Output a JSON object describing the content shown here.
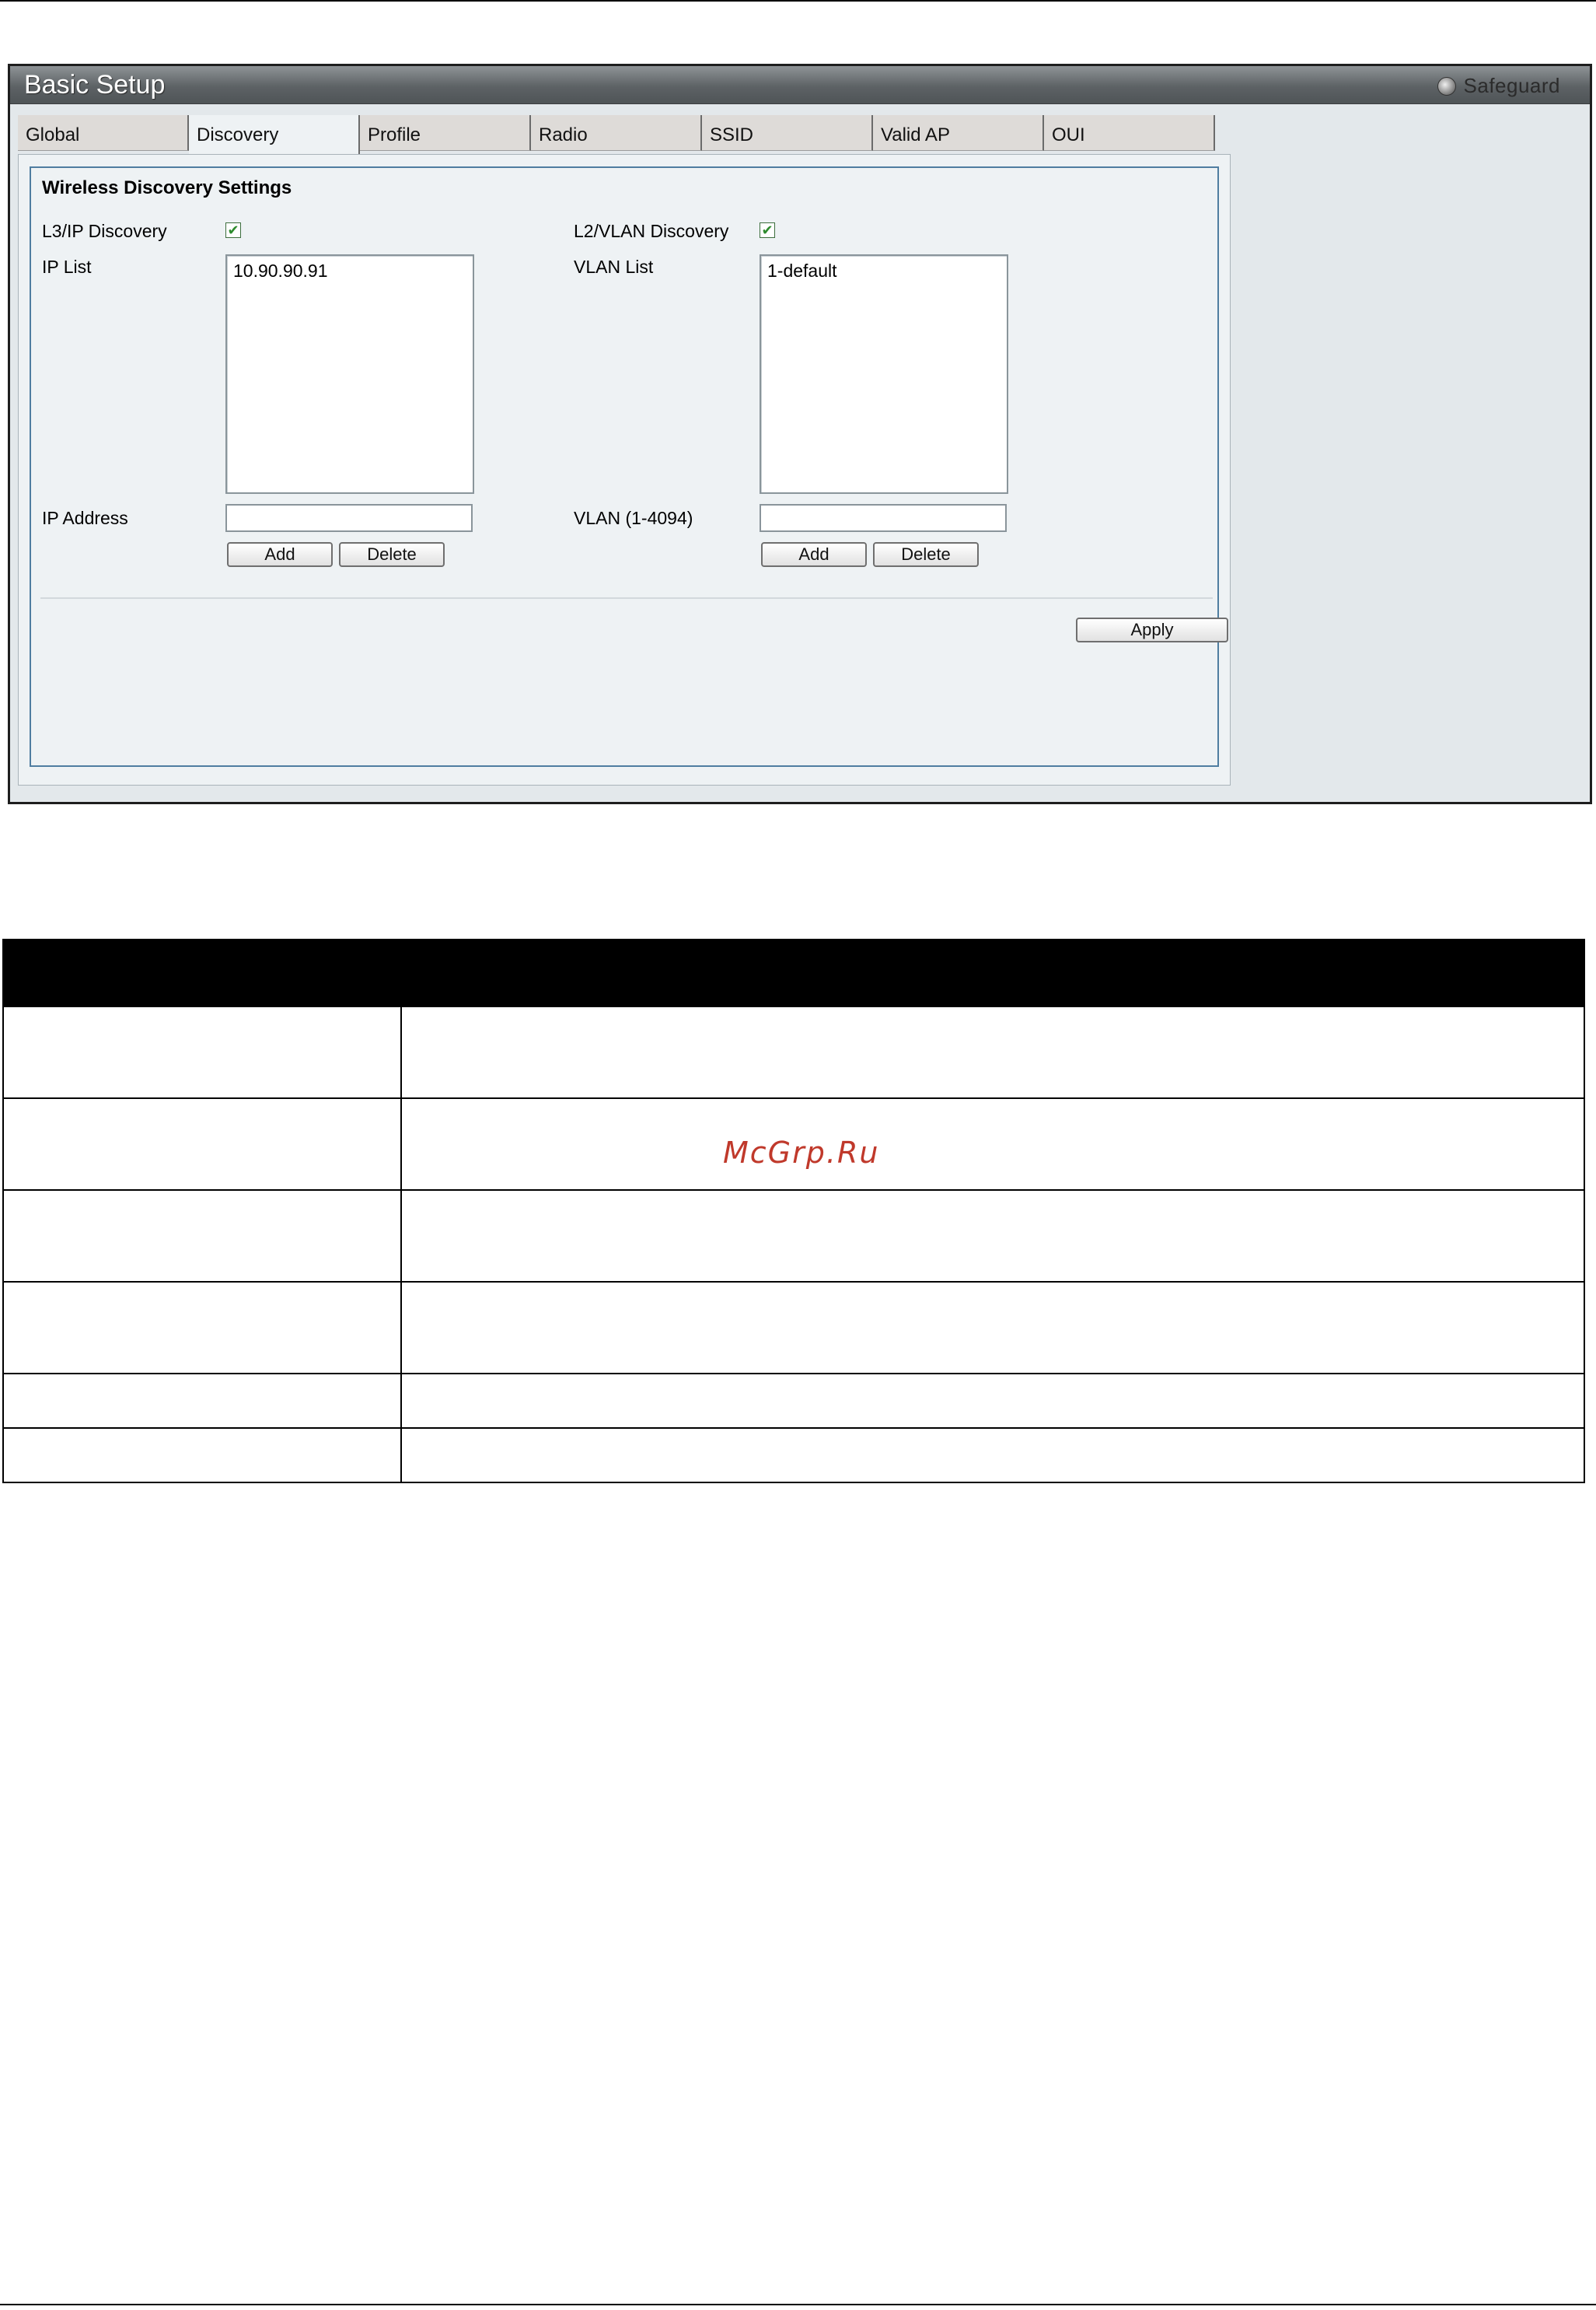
{
  "window": {
    "title": "Basic Setup",
    "safeguard_label": "Safeguard"
  },
  "tabs": [
    {
      "label": "Global",
      "active": false
    },
    {
      "label": "Discovery",
      "active": true
    },
    {
      "label": "Profile",
      "active": false
    },
    {
      "label": "Radio",
      "active": false
    },
    {
      "label": "SSID",
      "active": false
    },
    {
      "label": "Valid AP",
      "active": false
    },
    {
      "label": "OUI",
      "active": false
    }
  ],
  "discovery": {
    "section_title": "Wireless Discovery Settings",
    "l3": {
      "checkbox_label": "L3/IP Discovery",
      "checked": true,
      "list_label": "IP List",
      "list_items": [
        "10.90.90.91"
      ],
      "input_label": "IP Address",
      "input_value": "",
      "add_label": "Add",
      "delete_label": "Delete"
    },
    "l2": {
      "checkbox_label": "L2/VLAN Discovery",
      "checked": true,
      "list_label": "VLAN List",
      "list_items": [
        "1-default"
      ],
      "input_label": "VLAN (1-4094)",
      "input_value": "",
      "add_label": "Add",
      "delete_label": "Delete"
    },
    "apply_label": "Apply"
  },
  "doc_table": {
    "rows": 6
  },
  "watermark": "McGrp.Ru",
  "colors": {
    "titlebar": "#5d6265",
    "panel_bg": "#eef2f4",
    "fieldset_border": "#4f7da0",
    "checkmark": "#2e8b2e",
    "watermark": "#c0392b"
  }
}
